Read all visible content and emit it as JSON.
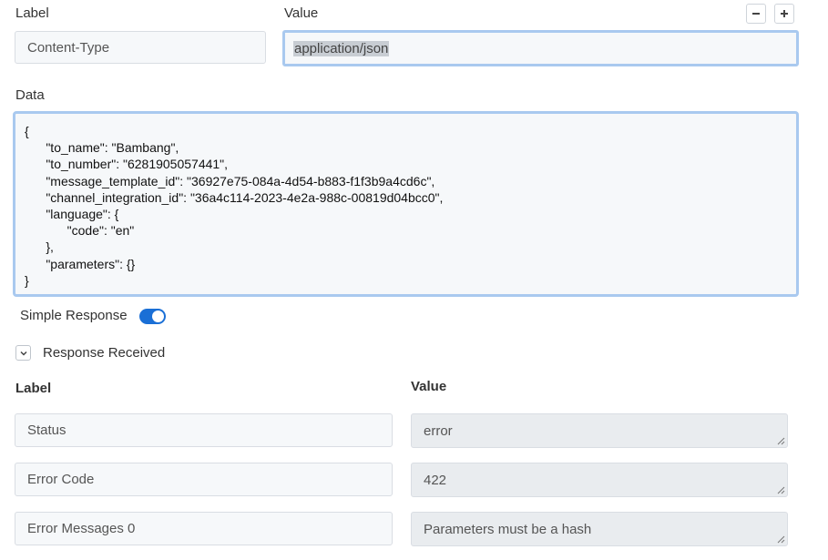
{
  "header": {
    "label_heading": "Label",
    "value_heading": "Value"
  },
  "top_row": {
    "label_value": "Content-Type",
    "value_value": "application/json"
  },
  "data_section": {
    "heading": "Data",
    "lines": [
      "{",
      "      \"to_name\": \"Bambang\",",
      "      \"to_number\": \"6281905057441\",",
      "      \"message_template_id\": \"36927e75-084a-4d54-b883-f1f3b9a4cd6c\",",
      "      \"channel_integration_id\": \"36a4c114-2023-4e2a-988c-00819d04bcc0\",",
      "      \"language\": {",
      "            \"code\": \"en\"",
      "      },",
      "      \"parameters\": {}",
      "}"
    ]
  },
  "simple_response": {
    "label": "Simple Response",
    "enabled": true
  },
  "response_received": {
    "label": "Response Received",
    "label_heading": "Label",
    "value_heading": "Value",
    "rows": [
      {
        "label": "Status",
        "value": "error"
      },
      {
        "label": "Error Code",
        "value": "422"
      },
      {
        "label": "Error Messages 0",
        "value": "Parameters must be a hash"
      }
    ]
  },
  "icons": {
    "minus": "minus-icon",
    "plus": "plus-icon",
    "chevron": "chevron-down-icon"
  },
  "colors": {
    "focus_border": "#a9c9ef",
    "toggle_on": "#1a6fd6",
    "field_bg": "#f6f8fa",
    "readonly_bg": "#e9ecef"
  }
}
